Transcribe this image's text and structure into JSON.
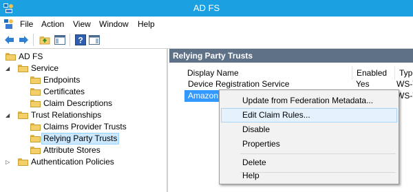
{
  "window": {
    "title": "AD FS"
  },
  "menu": [
    "File",
    "Action",
    "View",
    "Window",
    "Help"
  ],
  "toolbar": {
    "buttons": [
      "back-icon",
      "forward-icon",
      "up-folder-icon",
      "show-hide-tree-icon",
      "help-icon",
      "show-hide-action-pane-icon"
    ]
  },
  "tree": {
    "root": "AD FS",
    "service": "Service",
    "endpoints": "Endpoints",
    "certificates": "Certificates",
    "claim_descriptions": "Claim Descriptions",
    "trust_relationships": "Trust Relationships",
    "claims_provider_trusts": "Claims Provider Trusts",
    "relying_party_trusts": "Relying Party Trusts",
    "attribute_stores": "Attribute Stores",
    "authentication_policies": "Authentication Policies"
  },
  "pane": {
    "title": "Relying Party Trusts",
    "columns": [
      "Display Name",
      "Enabled",
      "Type"
    ],
    "rows": [
      {
        "name": "Device Registration Service",
        "enabled": "Yes",
        "type": "WS-T"
      },
      {
        "name": "Amazon W",
        "enabled": "",
        "type": "WS-T"
      }
    ]
  },
  "context_menu": {
    "items": [
      "Update from Federation Metadata...",
      "Edit Claim Rules...",
      "Disable",
      "Properties",
      "Delete",
      "Help"
    ]
  },
  "colors": {
    "titlebar": "#1ba1e2",
    "pane_header": "#5f7187",
    "selection": "#3399ff"
  }
}
